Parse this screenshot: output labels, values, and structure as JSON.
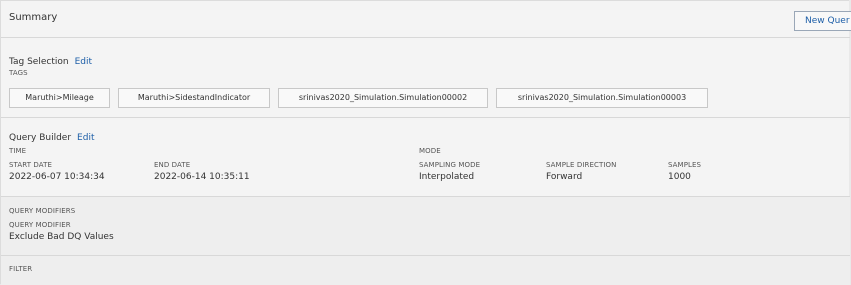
{
  "summary": {
    "title": "Summary",
    "new_query_label": "New Quer"
  },
  "tag_selection": {
    "heading": "Tag Selection",
    "edit_label": "Edit",
    "tags_label": "TAGS",
    "tags": [
      "Maruthi>Mileage",
      "Maruthi>SidestandIndicator",
      "srinivas2020_Simulation.Simulation00002",
      "srinivas2020_Simulation.Simulation00003"
    ]
  },
  "query_builder": {
    "heading": "Query Builder",
    "edit_label": "Edit",
    "time_label": "TIME",
    "start_date_label": "START DATE",
    "start_date_value": "2022-06-07 10:34:34",
    "end_date_label": "END DATE",
    "end_date_value": "2022-06-14 10:35:11",
    "mode_label": "MODE",
    "sampling_mode_label": "SAMPLING MODE",
    "sampling_mode_value": "Interpolated",
    "sample_direction_label": "SAMPLE DIRECTION",
    "sample_direction_value": "Forward",
    "samples_label": "SAMPLES",
    "samples_value": "1000"
  },
  "query_modifiers": {
    "heading": "QUERY MODIFIERS",
    "modifier_label": "QUERY MODIFIER",
    "modifier_value": "Exclude Bad DQ Values"
  },
  "filter": {
    "heading": "FILTER"
  }
}
